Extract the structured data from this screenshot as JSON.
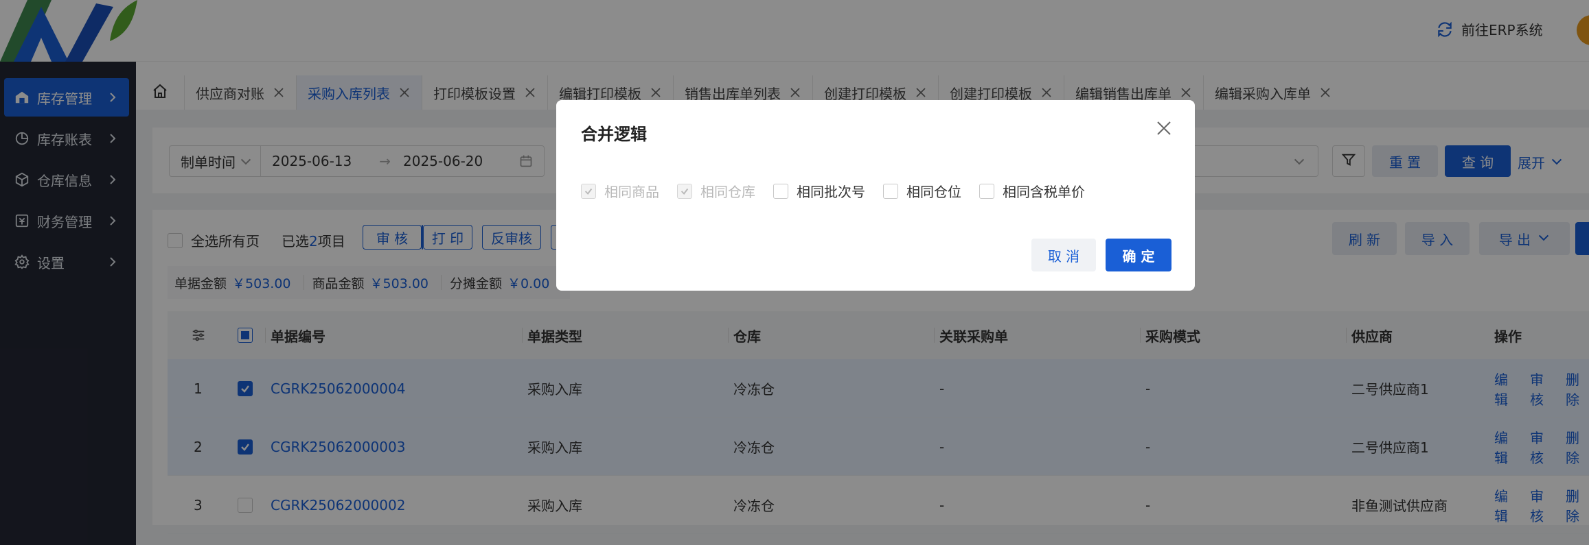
{
  "header": {
    "erp_link": "前往ERP系统",
    "erp_icon": "switch-icon"
  },
  "sidebar": {
    "items": [
      {
        "label": "库存管理",
        "icon": "warehouse-icon"
      },
      {
        "label": "库存账表",
        "icon": "pie-chart-icon"
      },
      {
        "label": "仓库信息",
        "icon": "box-icon"
      },
      {
        "label": "财务管理",
        "icon": "finance-icon"
      },
      {
        "label": "设置",
        "icon": "gear-icon"
      }
    ]
  },
  "tabs": [
    {
      "label": "供应商对账"
    },
    {
      "label": "采购入库列表"
    },
    {
      "label": "打印模板设置"
    },
    {
      "label": "编辑打印模板"
    },
    {
      "label": "销售出库单列表"
    },
    {
      "label": "创建打印模板"
    },
    {
      "label": "创建打印模板"
    },
    {
      "label": "编辑销售出库单"
    },
    {
      "label": "编辑采购入库单"
    }
  ],
  "filter": {
    "date_type": "制单时间",
    "date_start": "2025-06-13",
    "date_arrow": "→",
    "date_end": "2025-06-20",
    "reset": "重 置",
    "query": "查 询",
    "expand": "展开"
  },
  "toolbar": {
    "select_all": "全选所有页",
    "selected_prefix": "已选",
    "selected_count": "2",
    "selected_suffix": "项目",
    "audit": "审 核",
    "print": "打 印",
    "unaudit": "反审核",
    "refresh": "刷 新",
    "import": "导 入",
    "export": "导 出"
  },
  "amounts": {
    "doc_label": "单据金额",
    "doc_value": "￥503.00",
    "goods_label": "商品金额",
    "goods_value": "￥503.00",
    "share_label": "分摊金额",
    "share_value": "￥0.00"
  },
  "table": {
    "headers": [
      "单据编号",
      "单据类型",
      "仓库",
      "关联采购单",
      "采购模式",
      "供应商",
      "操作"
    ],
    "rows": [
      {
        "index": "1",
        "code": "CGRK25062000004",
        "type": "采购入库",
        "warehouse": "冷冻仓",
        "po": "-",
        "mode": "-",
        "supplier": "二号供应商1",
        "checked": true
      },
      {
        "index": "2",
        "code": "CGRK25062000003",
        "type": "采购入库",
        "warehouse": "冷冻仓",
        "po": "-",
        "mode": "-",
        "supplier": "二号供应商1",
        "checked": true
      },
      {
        "index": "3",
        "code": "CGRK25062000002",
        "type": "采购入库",
        "warehouse": "冷冻仓",
        "po": "-",
        "mode": "-",
        "supplier": "非鱼测试供应商",
        "checked": false
      }
    ],
    "ops": {
      "edit": "编辑",
      "audit": "审核",
      "delete": "删除"
    }
  },
  "dialog": {
    "title": "合并逻辑",
    "options": [
      {
        "label": "相同商品",
        "checked": true,
        "disabled": true
      },
      {
        "label": "相同仓库",
        "checked": true,
        "disabled": true
      },
      {
        "label": "相同批次号",
        "checked": false,
        "disabled": false
      },
      {
        "label": "相同仓位",
        "checked": false,
        "disabled": false
      },
      {
        "label": "相同含税单价",
        "checked": false,
        "disabled": false
      }
    ],
    "cancel": "取 消",
    "ok": "确 定"
  },
  "colors": {
    "primary": "#1a5fd6",
    "sidebar_bg": "#242734",
    "logo_blue": "#1a5fd6",
    "logo_green": "#5aa832"
  }
}
